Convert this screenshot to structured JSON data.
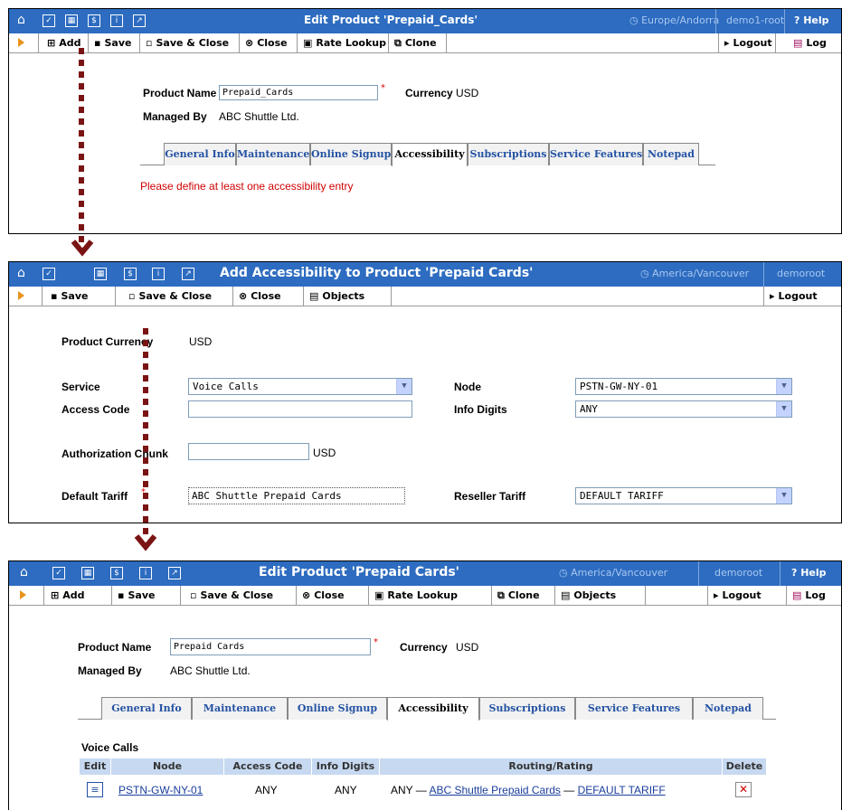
{
  "panel1": {
    "title": "Edit Product 'Prepaid_Cards'",
    "timezone": "Europe/Andorra",
    "user": "demo1-root",
    "help": "Help",
    "toolbar": {
      "add": "Add",
      "save": "Save",
      "save_close": "Save & Close",
      "close": "Close",
      "rate_lookup": "Rate Lookup",
      "clone": "Clone",
      "logout": "Logout",
      "log": "Log"
    },
    "product_name_label": "Product Name",
    "product_name_value": "Prepaid_Cards",
    "currency_label": "Currency",
    "currency_value": "USD",
    "managed_by_label": "Managed By",
    "managed_by_value": "ABC Shuttle Ltd.",
    "tabs": [
      "General Info",
      "Maintenance",
      "Online Signup",
      "Accessibility",
      "Subscriptions",
      "Service Features",
      "Notepad"
    ],
    "error": "Please define at least one accessibility entry"
  },
  "panel2": {
    "title": "Add Accessibility to Product 'Prepaid Cards'",
    "timezone": "America/Vancouver",
    "user": "demoroot",
    "toolbar": {
      "save": "Save",
      "save_close": "Save & Close",
      "close": "Close",
      "objects": "Objects",
      "logout": "Logout"
    },
    "product_currency_label": "Product Currency",
    "product_currency_value": "USD",
    "service_label": "Service",
    "service_value": "Voice Calls",
    "node_label": "Node",
    "node_value": "PSTN-GW-NY-01",
    "access_code_label": "Access Code",
    "access_code_value": "",
    "info_digits_label": "Info Digits",
    "info_digits_value": "ANY",
    "auth_chunk_label": "Authorization Chunk",
    "auth_chunk_value": "",
    "auth_chunk_unit": "USD",
    "default_tariff_label": "Default Tariff",
    "default_tariff_value": "ABC Shuttle Prepaid Cards",
    "reseller_tariff_label": "Reseller Tariff",
    "reseller_tariff_value": "DEFAULT TARIFF"
  },
  "panel3": {
    "title": "Edit Product 'Prepaid Cards'",
    "timezone": "America/Vancouver",
    "user": "demoroot",
    "help": "Help",
    "toolbar": {
      "add": "Add",
      "save": "Save",
      "save_close": "Save & Close",
      "close": "Close",
      "rate_lookup": "Rate Lookup",
      "clone": "Clone",
      "objects": "Objects",
      "logout": "Logout",
      "log": "Log"
    },
    "product_name_label": "Product Name",
    "product_name_value": "Prepaid Cards",
    "currency_label": "Currency",
    "currency_value": "USD",
    "managed_by_label": "Managed By",
    "managed_by_value": "ABC Shuttle Ltd.",
    "tabs": [
      "General Info",
      "Maintenance",
      "Online Signup",
      "Accessibility",
      "Subscriptions",
      "Service Features",
      "Notepad"
    ],
    "section_title": "Voice Calls",
    "columns": [
      "Edit",
      "Node",
      "Access Code",
      "Info Digits",
      "Routing/Rating",
      "Delete"
    ],
    "row": {
      "node": "PSTN-GW-NY-01",
      "access_code": "ANY",
      "info_digits": "ANY",
      "routing_any": "ANY —",
      "tariff": "ABC Shuttle Prepaid Cards",
      "dash": "—",
      "reseller": "DEFAULT TARIFF"
    }
  },
  "colors": {
    "titlebar": "#2d6cc0",
    "error": "#d00000",
    "link": "#1a3e9c",
    "dotted_arrow": "#7a1414",
    "grid_header": "#c7d9f1"
  }
}
